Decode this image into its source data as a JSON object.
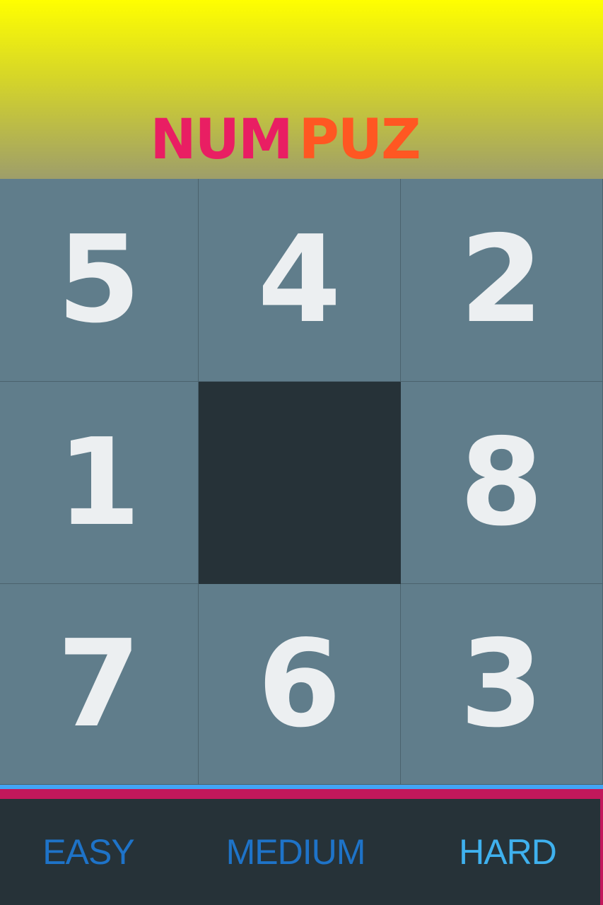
{
  "header": {
    "logo_part1": "NUM",
    "logo_part2": "PUZ",
    "logo_color1": "#e91e63",
    "logo_color2": "#ff5722"
  },
  "board": {
    "rows": 3,
    "cols": 3,
    "tiles": [
      "5",
      "4",
      "2",
      "1",
      "",
      "8",
      "7",
      "6",
      "3"
    ],
    "tile_color": "#607d8b",
    "empty_color": "#263238",
    "number_color": "#eceff1"
  },
  "tabs": {
    "easy": "EASY",
    "medium": "MEDIUM",
    "hard": "HARD",
    "selected": "HARD"
  }
}
